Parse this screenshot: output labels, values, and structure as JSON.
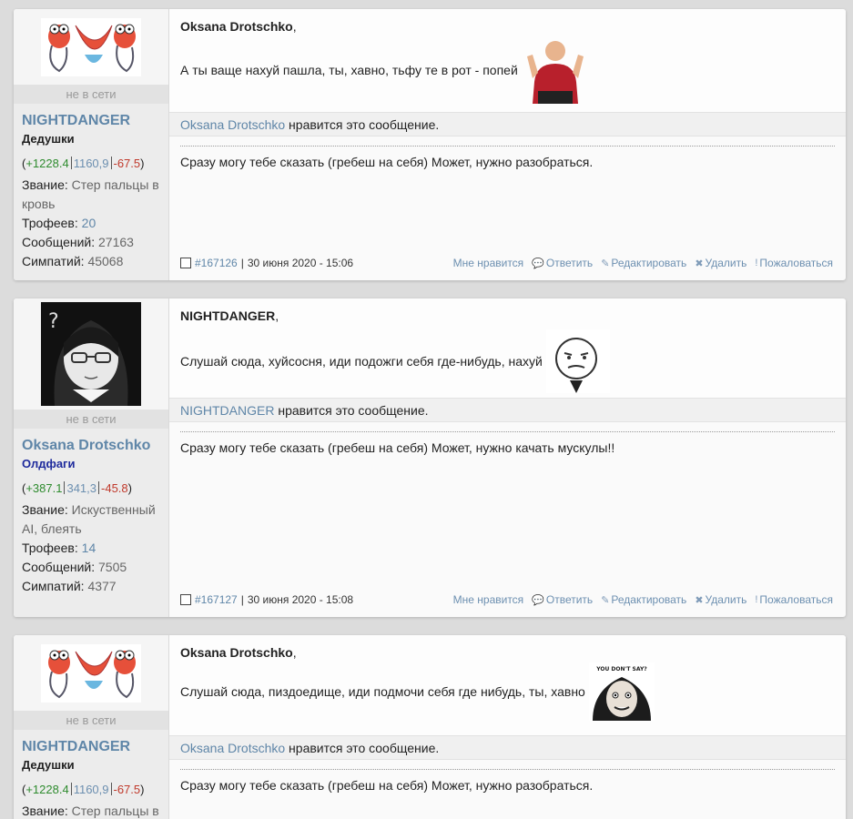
{
  "posts": [
    {
      "user": {
        "status": "не в сети",
        "name": "NIGHTDANGER",
        "group": "Дедушки",
        "rep_pos": "+1228.4",
        "rep_neu": "1160,9",
        "rep_neg": "-67.5",
        "rank_label": "Звание:",
        "rank": "Стер пальцы в кровь",
        "trophies_label": "Трофеев:",
        "trophies": "20",
        "messages_label": "Сообщений:",
        "messages": "27163",
        "sympathy_label": "Симпатий:",
        "sympathy": "45068"
      },
      "quoted": "Oksana Drotschko",
      "comma": ",",
      "text": "А ты ваще нахуй пашла, ты, хавно, тьфу те в рот - попей",
      "like_user": "Oksana Drotschko",
      "like_text": " нравится это сообщение.",
      "signature": "Сразу могу тебе сказать (гребеш на себя) Может, нужно разобраться.",
      "post_id": "#167126",
      "date": "30 июня 2020 - 15:06"
    },
    {
      "user": {
        "status": "не в сети",
        "name": "Oksana Drotschko",
        "group": "Олдфаги",
        "rep_pos": "+387.1",
        "rep_neu": "341,3",
        "rep_neg": "-45.8",
        "rank_label": "Звание:",
        "rank": "Искуственный AI, блеять",
        "trophies_label": "Трофеев:",
        "trophies": "14",
        "messages_label": "Сообщений:",
        "messages": "7505",
        "sympathy_label": "Симпатий:",
        "sympathy": "4377"
      },
      "quoted": "NIGHTDANGER",
      "comma": ",",
      "text": "Слушай сюда, хуйсосня, иди подожги себя где-нибудь, нахуй",
      "like_user": "NIGHTDANGER",
      "like_text": " нравится это сообщение.",
      "signature": "Сразу могу тебе сказать (гребеш на себя) Может, нужно качать мускулы!!",
      "post_id": "#167127",
      "date": "30 июня 2020 - 15:08"
    },
    {
      "user": {
        "status": "не в сети",
        "name": "NIGHTDANGER",
        "group": "Дедушки",
        "rep_pos": "+1228.4",
        "rep_neu": "1160,9",
        "rep_neg": "-67.5",
        "rank_label": "Звание:",
        "rank": "Стер пальцы в"
      },
      "quoted": "Oksana Drotschko",
      "comma": ",",
      "text": "Слушай сюда, пиздоедище, иди подмочи себя где нибудь, ты, хавно",
      "meme_caption": "YOU DON'T SAY?",
      "like_user": "Oksana Drotschko",
      "like_text": " нравится это сообщение.",
      "signature": "Сразу могу тебе сказать (гребеш на себя) Может, нужно разобраться."
    }
  ],
  "actions": {
    "like": "Мне нравится",
    "reply": "Ответить",
    "edit": "Редактировать",
    "delete": "Удалить",
    "report": "Пожаловаться"
  },
  "icons": {
    "reply": "speech-bubble-icon",
    "edit": "pencil-icon",
    "delete": "close-icon",
    "report": "exclamation-icon"
  },
  "colors": {
    "link": "#5f86a8",
    "positive": "#2e8b2e",
    "negative": "#c0392b",
    "group_oldfag": "#1e2a9c"
  }
}
